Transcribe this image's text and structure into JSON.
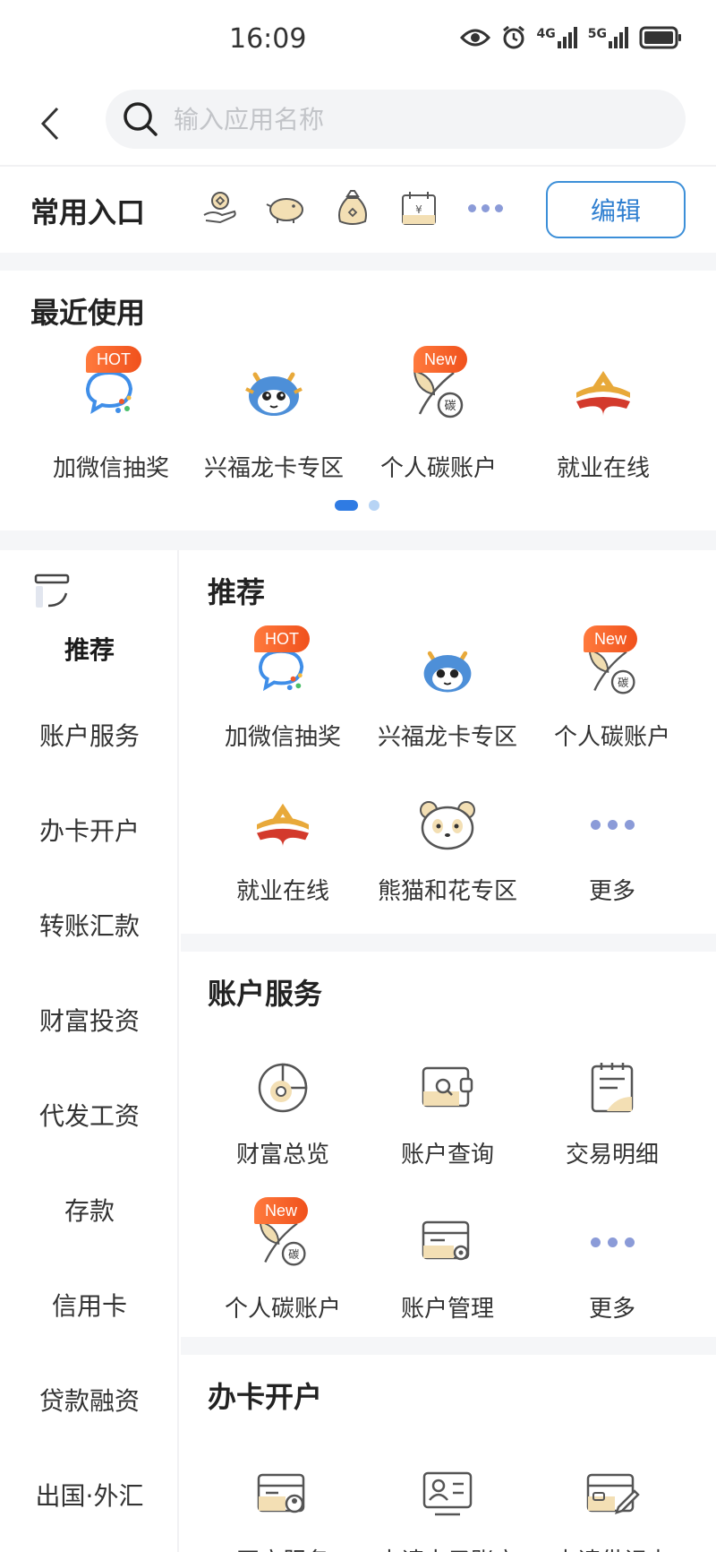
{
  "status_bar": {
    "time": "16:09",
    "net1": "4G",
    "net2": "5G"
  },
  "search": {
    "placeholder": "输入应用名称"
  },
  "favorites": {
    "title": "常用入口",
    "edit_label": "编辑",
    "icons": [
      "hand-coin-icon",
      "piggy-bank-icon",
      "money-bag-icon",
      "calendar-yuan-icon",
      "more-dots-icon"
    ]
  },
  "recent": {
    "title": "最近使用",
    "items": [
      {
        "label": "加微信抽奖",
        "icon": "wechat-lottery-icon",
        "badge": "HOT"
      },
      {
        "label": "兴福龙卡专区",
        "icon": "dragon-mascot-icon",
        "badge": ""
      },
      {
        "label": "个人碳账户",
        "icon": "carbon-leaf-icon",
        "badge": "New"
      },
      {
        "label": "就业在线",
        "icon": "employment-logo-icon",
        "badge": ""
      }
    ],
    "pager": {
      "pages": 2,
      "active": 1
    }
  },
  "nav": {
    "items": [
      "推荐",
      "账户服务",
      "办卡开户",
      "转账汇款",
      "财富投资",
      "代发工资",
      "存款",
      "信用卡",
      "贷款融资",
      "出国·外汇"
    ],
    "active": "推荐"
  },
  "sections": [
    {
      "title": "推荐",
      "items": [
        {
          "label": "加微信抽奖",
          "icon": "wechat-lottery-icon",
          "badge": "HOT"
        },
        {
          "label": "兴福龙卡专区",
          "icon": "dragon-mascot-icon",
          "badge": ""
        },
        {
          "label": "个人碳账户",
          "icon": "carbon-leaf-icon",
          "badge": "New"
        },
        {
          "label": "就业在线",
          "icon": "employment-logo-icon",
          "badge": ""
        },
        {
          "label": "熊猫和花专区",
          "icon": "panda-icon",
          "badge": ""
        },
        {
          "label": "更多",
          "icon": "more-dots-icon",
          "badge": ""
        }
      ]
    },
    {
      "title": "账户服务",
      "items": [
        {
          "label": "财富总览",
          "icon": "pie-chart-icon",
          "badge": ""
        },
        {
          "label": "账户查询",
          "icon": "wallet-search-icon",
          "badge": ""
        },
        {
          "label": "交易明细",
          "icon": "notepad-icon",
          "badge": ""
        },
        {
          "label": "个人碳账户",
          "icon": "carbon-leaf-icon",
          "badge": "New"
        },
        {
          "label": "账户管理",
          "icon": "card-gear-icon",
          "badge": ""
        },
        {
          "label": "更多",
          "icon": "more-dots-icon",
          "badge": ""
        }
      ]
    },
    {
      "title": "办卡开户",
      "items": [
        {
          "label": "开户服务",
          "icon": "card-user-icon",
          "badge": ""
        },
        {
          "label": "申请电子账户",
          "icon": "id-card-icon",
          "badge": ""
        },
        {
          "label": "申请借记卡",
          "icon": "card-pen-icon",
          "badge": ""
        }
      ]
    }
  ],
  "colors": {
    "accent": "#2f7be3",
    "badge": "#f0511c",
    "icon_gold": "#e9c98a",
    "dots": "#8b9bd8"
  }
}
